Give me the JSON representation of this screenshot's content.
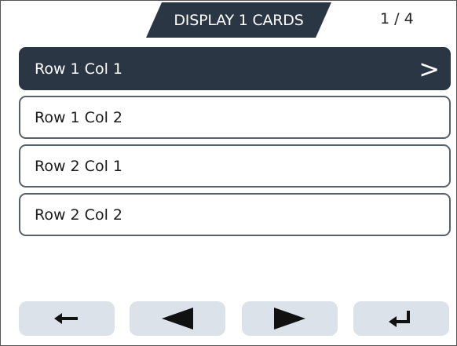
{
  "header": {
    "title": "DISPLAY 1 CARDS",
    "page_indicator": "1 / 4"
  },
  "cards": [
    {
      "label": "Row 1 Col 1",
      "selected": true
    },
    {
      "label": "Row 1 Col 2",
      "selected": false
    },
    {
      "label": "Row 2 Col 1",
      "selected": false
    },
    {
      "label": "Row 2 Col 2",
      "selected": false
    }
  ],
  "selected_chevron": ">",
  "footer": {
    "buttons": [
      {
        "name": "back",
        "icon": "arrow-left-icon"
      },
      {
        "name": "previous",
        "icon": "triangle-left-icon"
      },
      {
        "name": "next",
        "icon": "triangle-right-icon"
      },
      {
        "name": "enter",
        "icon": "return-icon"
      }
    ]
  },
  "colors": {
    "accent_dark": "#2b3644",
    "button_bg": "#dbe2ea",
    "card_border": "#57616d"
  }
}
